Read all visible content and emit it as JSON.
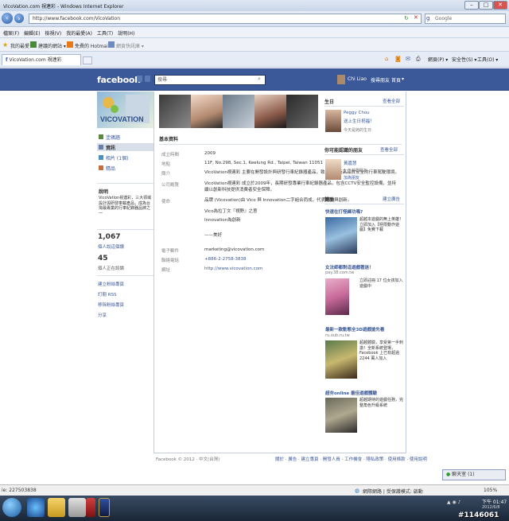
{
  "window": {
    "title": "VicoVation.com 視連彩 - Windows Internet Explorer",
    "url": "http://www.facebook.com/VicoVation",
    "search_placeholder": "Google",
    "menu": [
      "檔案(F)",
      "編輯(E)",
      "檢視(V)",
      "我的最愛(A)",
      "工具(T)",
      "說明(H)"
    ],
    "favorites_label": "我的最愛",
    "fav_items": [
      "建議的網站 ▾",
      "免費的 Hotmail",
      "網頁快訊庫 ▾"
    ],
    "tab_label": "VicoVation.com 視連彩",
    "commands": [
      "網頁(P) ▾",
      "安全性(S) ▾",
      "工具(O) ▾"
    ]
  },
  "facebook": {
    "logo": "facebook",
    "search_placeholder": "搜尋",
    "user_name": "Chi Liao",
    "nav": [
      "搜尋朋友",
      "首頁",
      "▾"
    ],
    "page_name": "VICOVATION",
    "sidebar": {
      "links": [
        "塗鴉牆",
        "資訊",
        "相片 (1個)",
        "精品"
      ],
      "about_title": "說明",
      "about_text": "VicoVation視連彩，三大領域設計與研發車載產品，成為台灣最專業的行車紀錄器品牌之一",
      "stats": [
        {
          "num": "1,067",
          "label": "個人說這個讚"
        },
        {
          "num": "45",
          "label": "個人正在談論"
        }
      ],
      "actions": [
        "建立粉絲專頁",
        "訂閱 RSS",
        "移除粉絲專頁",
        "分享"
      ]
    },
    "info": {
      "section_title": "基本資料",
      "rows": [
        {
          "label": "成立時間",
          "value": "2009"
        },
        {
          "label": "地點",
          "value": "11F, No.298, Sec.1, Keelung Rd., Taipei, Taiwan 11051"
        },
        {
          "label": "簡介",
          "value": "VicoVation視連彩 主要在開發設計與研發行車紀錄器產品，致力於創造高品質安全的行車駕駛環境。"
        },
        {
          "label": "公司概覽",
          "value": "VicoVation視連彩 成立於2009年，長期研發專業行車紀錄器產品，包含CCTV安全監控設備，並持續以創新科技提供消費者安全保障。"
        },
        {
          "label": "使命",
          "value": "品牌 (Vicovation)由 Vico 與 Innovation二字組合而成，代表視覺與創新。"
        }
      ],
      "mission_extra": [
        "Vico為拉丁文『視野』之意",
        "Innovation為創新",
        "——美好"
      ],
      "contact_rows": [
        {
          "label": "電子郵件",
          "value": "marketing@vicovation.com"
        },
        {
          "label": "聯絡電話",
          "value": "+886-2-2758-3838"
        },
        {
          "label": "網址",
          "value": "http://www.vicovation.com"
        }
      ]
    },
    "right": {
      "birthday": {
        "title": "生日",
        "see_all": "查看全部",
        "name": "Peggy Chou",
        "text": "送上生日祝福！",
        "sub": "今天是她的生日"
      },
      "friends": {
        "title": "你可能認識的朋友",
        "see_all": "查看全部",
        "name": "黃嘉慧",
        "sub": "1 位共同朋友",
        "add": "加為朋友"
      },
      "ads": {
        "title": "贊助",
        "see_all": "建立廣告",
        "items": [
          {
            "title": "快速在打怪練功嗎?",
            "text": "超越本遊戲的無上英雄！立即加入【極限動作遊戲】免費下載",
            "domain": ""
          },
          {
            "title": "女法師都對這遊戲著迷！",
            "domain": "pay.38.com.tw",
            "text": "立即註冊 17 位女孩加入遊戲中"
          },
          {
            "title": "最新一款動態全3D遊戲搶先看",
            "domain": "ru.oub.ru.tw",
            "text": "超越體驗，享受第一手刺激！全新系統登場，Facebook 上已有超過 2244 萬人加入"
          },
          {
            "title": "超夯online 最佳遊戲體驗",
            "domain": "",
            "text": "超越期待的遊戲任務，完整角色升級系統"
          }
        ]
      }
    },
    "footer": {
      "copyright": "Facebook © 2012 · 中文(台灣)",
      "links": [
        "關於",
        "廣告",
        "建立專頁",
        "開發人員",
        "工作機會",
        "隱私政策",
        "使用條款",
        "使用說明"
      ]
    },
    "chat": "聊天室 (1)"
  },
  "status": {
    "left": "ie: 227503838",
    "zone": "網際網路 | 受保護模式: 啟動",
    "zoom": "105%"
  },
  "taskbar": {
    "time": "下午 01:47",
    "date": "2012/6/8",
    "watermark": "#1146061"
  }
}
